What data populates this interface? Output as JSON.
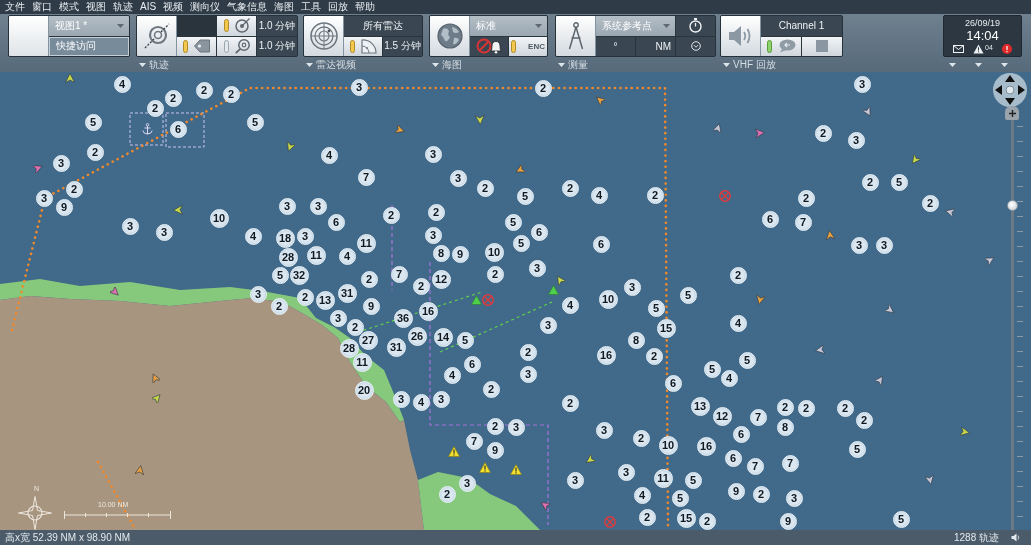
{
  "menu_bar": {
    "items": [
      "文件",
      "窗口",
      "模式",
      "视图",
      "轨迹",
      "AIS",
      "视频",
      "测向仪",
      "气象信息",
      "海图",
      "工具",
      "回放",
      "帮助"
    ]
  },
  "toolbar": {
    "view": {
      "view_select": "视图1 *",
      "quick_access": "快捷访问"
    },
    "tracks": {
      "label": "轨迹",
      "tag_filter": {
        "on": true
      },
      "target_filter": {
        "on": true,
        "time": "1.0 分钟"
      },
      "search_filter": {
        "on": false,
        "time": "1.0 分钟"
      }
    },
    "radar_video": {
      "label": "雷达视频",
      "source_select": "所有雷达",
      "sector": {
        "on": true
      },
      "time": "1.5 分钟"
    },
    "chart": {
      "label": "海图",
      "mode_select": "标准",
      "enc": {
        "on": true,
        "text": "ENC"
      }
    },
    "measure": {
      "label": "测量",
      "reference_select": "系统参考点",
      "bearing_unit": "°",
      "distance_unit": "NM"
    },
    "vhf_playback": {
      "label": "VHF 回放",
      "channel": "Channel 1",
      "talk": {
        "on": true
      }
    },
    "clock": {
      "date": "26/09/19",
      "time": "14:04",
      "alarm_count": "04"
    }
  },
  "map": {
    "north_label": "N",
    "scale_label": "10.00 NM",
    "zoom": {
      "level": 0.8
    },
    "clusters": [
      {
        "count": "4"
      },
      {
        "count": "5"
      },
      {
        "count": "2"
      },
      {
        "count": "2"
      },
      {
        "count": "2"
      },
      {
        "count": "2"
      },
      {
        "count": "3"
      },
      {
        "count": "2"
      },
      {
        "count": "3"
      },
      {
        "count": "6"
      },
      {
        "count": "5"
      },
      {
        "count": "2"
      },
      {
        "count": "3"
      },
      {
        "count": "2"
      },
      {
        "count": "4"
      },
      {
        "count": "3"
      },
      {
        "count": "3"
      },
      {
        "count": "3"
      },
      {
        "count": "2"
      },
      {
        "count": "7"
      },
      {
        "count": "3"
      },
      {
        "count": "2"
      },
      {
        "count": "9"
      },
      {
        "count": "3"
      },
      {
        "count": "3"
      },
      {
        "count": "10"
      },
      {
        "count": "3"
      },
      {
        "count": "3"
      },
      {
        "count": "4"
      },
      {
        "count": "18"
      },
      {
        "count": "3"
      },
      {
        "count": "6"
      },
      {
        "count": "2"
      },
      {
        "count": "2"
      },
      {
        "count": "5"
      },
      {
        "count": "2"
      },
      {
        "count": "4"
      },
      {
        "count": "2"
      },
      {
        "count": "2"
      },
      {
        "count": "2"
      },
      {
        "count": "5"
      },
      {
        "count": "28"
      },
      {
        "count": "11"
      },
      {
        "count": "4"
      },
      {
        "count": "11"
      },
      {
        "count": "3"
      },
      {
        "count": "5"
      },
      {
        "count": "8"
      },
      {
        "count": "9"
      },
      {
        "count": "10"
      },
      {
        "count": "5"
      },
      {
        "count": "6"
      },
      {
        "count": "6"
      },
      {
        "count": "2"
      },
      {
        "count": "7"
      },
      {
        "count": "6"
      },
      {
        "count": "3"
      },
      {
        "count": "3"
      },
      {
        "count": "5"
      },
      {
        "count": "32"
      },
      {
        "count": "3"
      },
      {
        "count": "2"
      },
      {
        "count": "2"
      },
      {
        "count": "13"
      },
      {
        "count": "31"
      },
      {
        "count": "2"
      },
      {
        "count": "7"
      },
      {
        "count": "2"
      },
      {
        "count": "12"
      },
      {
        "count": "2"
      },
      {
        "count": "3"
      },
      {
        "count": "3"
      },
      {
        "count": "9"
      },
      {
        "count": "2"
      },
      {
        "count": "36"
      },
      {
        "count": "16"
      },
      {
        "count": "4"
      },
      {
        "count": "10"
      },
      {
        "count": "3"
      },
      {
        "count": "2"
      },
      {
        "count": "5"
      },
      {
        "count": "5"
      },
      {
        "count": "28"
      },
      {
        "count": "27"
      },
      {
        "count": "11"
      },
      {
        "count": "31"
      },
      {
        "count": "26"
      },
      {
        "count": "14"
      },
      {
        "count": "5"
      },
      {
        "count": "3"
      },
      {
        "count": "20"
      },
      {
        "count": "4"
      },
      {
        "count": "6"
      },
      {
        "count": "2"
      },
      {
        "count": "16"
      },
      {
        "count": "8"
      },
      {
        "count": "15"
      },
      {
        "count": "4"
      },
      {
        "count": "2"
      },
      {
        "count": "3"
      },
      {
        "count": "4"
      },
      {
        "count": "3"
      },
      {
        "count": "2"
      },
      {
        "count": "3"
      },
      {
        "count": "6"
      },
      {
        "count": "5"
      },
      {
        "count": "5"
      },
      {
        "count": "4"
      },
      {
        "count": "2"
      },
      {
        "count": "13"
      },
      {
        "count": "7"
      },
      {
        "count": "2"
      },
      {
        "count": "3"
      },
      {
        "count": "3"
      },
      {
        "count": "12"
      },
      {
        "count": "7"
      },
      {
        "count": "2"
      },
      {
        "count": "2"
      },
      {
        "count": "2"
      },
      {
        "count": "9"
      },
      {
        "count": "2"
      },
      {
        "count": "10"
      },
      {
        "count": "16"
      },
      {
        "count": "6"
      },
      {
        "count": "8"
      },
      {
        "count": "2"
      },
      {
        "count": "2"
      },
      {
        "count": "3"
      },
      {
        "count": "3"
      },
      {
        "count": "3"
      },
      {
        "count": "4"
      },
      {
        "count": "11"
      },
      {
        "count": "6"
      },
      {
        "count": "5"
      },
      {
        "count": "7"
      },
      {
        "count": "7"
      },
      {
        "count": "5"
      },
      {
        "count": "5"
      },
      {
        "count": "9"
      },
      {
        "count": "2"
      },
      {
        "count": "3"
      },
      {
        "count": "2"
      },
      {
        "count": "15"
      },
      {
        "count": "2"
      },
      {
        "count": "9"
      },
      {
        "count": "5"
      }
    ]
  },
  "status_bar": {
    "extent": "高x宽 52.39 NM x 98.90 NM",
    "track_count": "1288 轨迹"
  }
}
